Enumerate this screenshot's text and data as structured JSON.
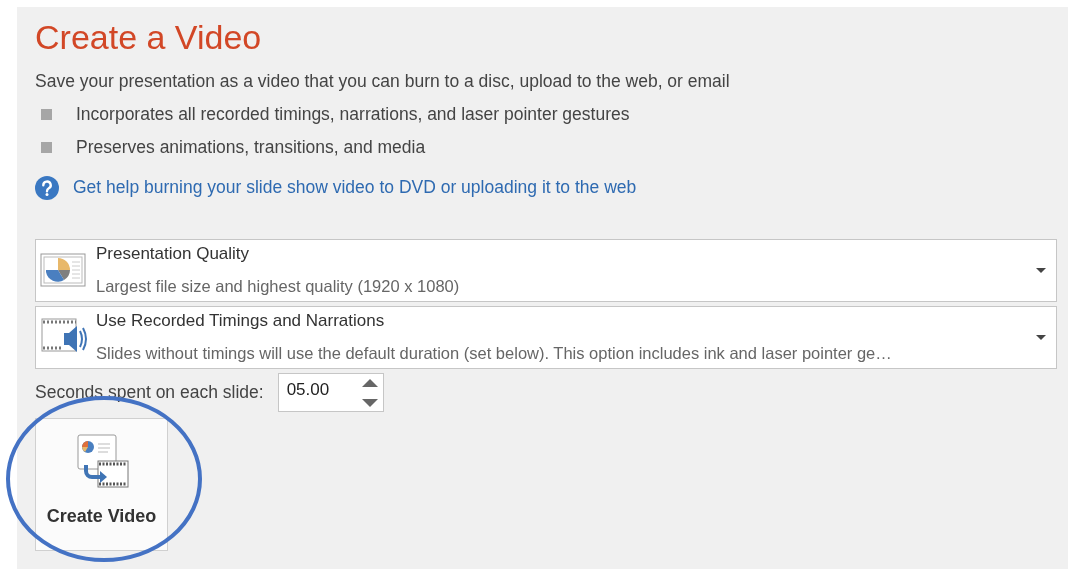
{
  "title": "Create a Video",
  "description": "Save your presentation as a video that you can burn to a disc, upload to the web, or email",
  "bullets": [
    "Incorporates all recorded timings, narrations, and laser pointer gestures",
    "Preserves animations, transitions, and media"
  ],
  "help_link": "Get help burning your slide show video to DVD or uploading it to the web",
  "dropdowns": [
    {
      "kind": "quality",
      "label": "Presentation Quality",
      "detail": "Largest file size and highest quality (1920 x 1080)"
    },
    {
      "kind": "timings",
      "label": "Use Recorded Timings and Narrations",
      "detail": "Slides without timings will use the default duration (set below). This option includes ink and laser pointer ge…"
    }
  ],
  "seconds": {
    "label": "Seconds spent on each slide:",
    "value": "05.00"
  },
  "create_button": {
    "label": "Create Video",
    "highlighted": true
  }
}
